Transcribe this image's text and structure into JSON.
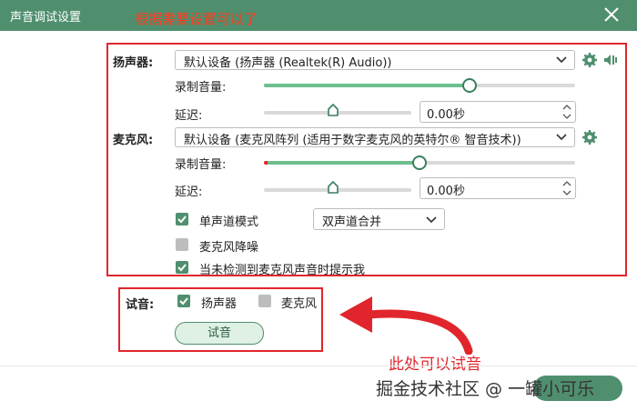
{
  "window": {
    "title": "声音调试设置"
  },
  "annotations": {
    "top": "根据需要设置可以了",
    "bottom": "此处可以试音"
  },
  "speaker": {
    "label": "扬声器:",
    "device": "默认设备 (扬声器 (Realtek(R) Audio))",
    "record_volume_label": "录制音量:",
    "record_volume": 0.66,
    "delay_label": "延迟:",
    "delay_position": 0.47,
    "delay_value": "0.00秒"
  },
  "mic": {
    "label": "麦克风:",
    "device": "默认设备 (麦克风阵列 (适用于数字麦克风的英特尔® 智音技术))",
    "record_volume_label": "录制音量:",
    "record_volume": 0.5,
    "delay_label": "延迟:",
    "delay_position": 0.47,
    "delay_value": "0.00秒"
  },
  "options": {
    "mono_label": "单声道模式",
    "mono_checked": true,
    "mono_mode": "双声道合并",
    "noise_label": "麦克风降噪",
    "noise_checked": false,
    "notify_label": "当未检测到麦克风声音时提示我",
    "notify_checked": true
  },
  "test": {
    "label": "试音:",
    "speaker_label": "扬声器",
    "speaker_checked": true,
    "mic_label": "麦克风",
    "mic_checked": false,
    "button": "试音"
  },
  "watermark": "掘金技术社区 @ 一罐小可乐",
  "colors": {
    "accent": "#4f8f6e",
    "annotation": "#e0262c",
    "slider_fill": "#6dbf8e"
  },
  "icons": [
    "close-icon",
    "gear-icon",
    "speaker-test-icon",
    "chevron-down-icon",
    "check-icon",
    "arrow-icon"
  ]
}
